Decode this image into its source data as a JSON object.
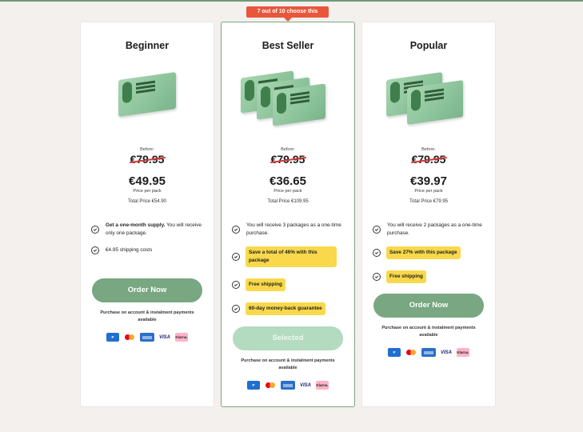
{
  "ribbon": "7 out of 10 choose this",
  "plans": [
    {
      "title": "Beginner",
      "before_label": "Before:",
      "old_price": "€79.95",
      "new_price": "€49.95",
      "per_pack": "Price per pack",
      "total": "Total Price €54.90",
      "features": [
        {
          "bold": "Get a one-month supply.",
          "text": " You will receive only one package."
        },
        {
          "text": "€4.95 shipping costs"
        }
      ],
      "button": "Order Now",
      "account": "Purchase on account & instalment payments available"
    },
    {
      "title": "Best Seller",
      "before_label": "Before:",
      "old_price": "€79.95",
      "new_price": "€36.65",
      "per_pack": "Price per pack",
      "total": "Total Price €109.95",
      "features": [
        {
          "text": "You will receive 3 packages as a one-time purchase."
        },
        {
          "pill": "Save a total of 46% with this package"
        },
        {
          "pill": "Free shipping"
        },
        {
          "pill": "60-day money-back guarantee"
        }
      ],
      "button": "Selected",
      "account": "Purchase on account & instalment payments available"
    },
    {
      "title": "Popular",
      "before_label": "Before:",
      "old_price": "€79.95",
      "new_price": "€39.97",
      "per_pack": "Price per pack",
      "total": "Total Price €79.95",
      "features": [
        {
          "text": "You will receive 2 packages as a one-time purchase."
        },
        {
          "pill": "Save 27% with this package"
        },
        {
          "pill": "Free shipping"
        }
      ],
      "button": "Order Now",
      "account": "Purchase on account & instalment payments available"
    }
  ],
  "payment": {
    "paypal": "P",
    "amex": "AMERICAN EXPRESS",
    "visa": "VISA",
    "klarna": "Klarna."
  },
  "colors": {
    "accent_green": "#78a781",
    "selected_green": "#b3dbbf",
    "highlight_yellow": "#f9d94b",
    "ribbon_red": "#e8573b",
    "strike_red": "#d33a3a"
  }
}
